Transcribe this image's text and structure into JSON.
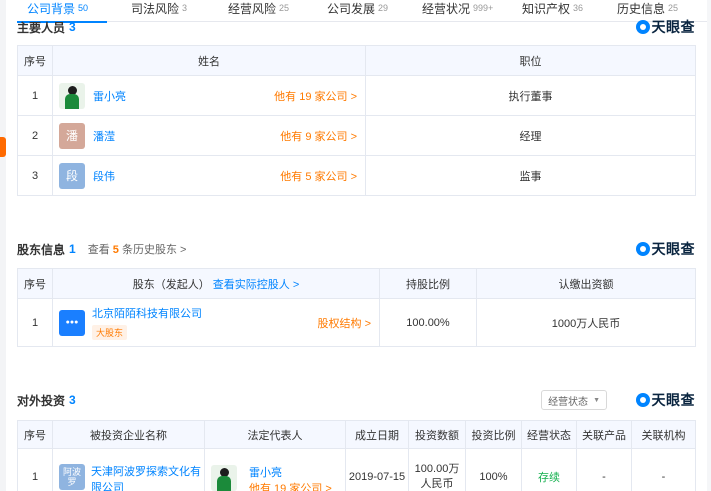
{
  "top_tabs": [
    {
      "label": "公司背景",
      "count": "50",
      "active": true
    },
    {
      "label": "司法风险",
      "count": "3"
    },
    {
      "label": "经营风险",
      "count": "25"
    },
    {
      "label": "公司发展",
      "count": "29"
    },
    {
      "label": "经营状况",
      "count": "999+"
    },
    {
      "label": "知识产权",
      "count": "36"
    },
    {
      "label": "历史信息",
      "count": "25"
    }
  ],
  "brand": {
    "logo_text": "天眼查"
  },
  "personnel": {
    "title": "主要人员",
    "count": "3",
    "headers": {
      "index": "序号",
      "name": "姓名",
      "position": "职位"
    },
    "rows": [
      {
        "index": "1",
        "name": "雷小亮",
        "more": "他有 19 家公司 >",
        "position": "执行董事"
      },
      {
        "index": "2",
        "avatar_char": "潘",
        "name": "潘滢",
        "more": "他有 9 家公司 >",
        "position": "经理"
      },
      {
        "index": "3",
        "avatar_char": "段",
        "name": "段伟",
        "more": "他有 5 家公司 >",
        "position": "监事"
      }
    ]
  },
  "shareholders": {
    "title": "股东信息",
    "count": "1",
    "history_prefix": "查看",
    "history_count": "5",
    "history_suffix": "条历史股东 >",
    "headers": {
      "index": "序号",
      "holder": "股东（发起人）",
      "holder_link": "查看实际控股人 >",
      "ratio": "持股比例",
      "capital": "认缴出资额"
    },
    "rows": [
      {
        "index": "1",
        "name": "北京陌陌科技有限公司",
        "tag": "大股东",
        "structure": "股权结构 >",
        "ratio": "100.00%",
        "capital": "1000万人民币"
      }
    ]
  },
  "investments": {
    "title": "对外投资",
    "count": "3",
    "filter_label": "经营状态",
    "headers": {
      "index": "序号",
      "company": "被投资企业名称",
      "legal_rep": "法定代表人",
      "date": "成立日期",
      "amount": "投资数额",
      "ratio": "投资比例",
      "status": "经营状态",
      "product": "关联产品",
      "org": "关联机构"
    },
    "rows": [
      {
        "index": "1",
        "logo_text": "阿波罗",
        "company": "天津阿波罗探索文化有限公司",
        "rep": "雷小亮",
        "rep_more": "他有 19 家公司 >",
        "date": "2019-07-15",
        "amount": "100.00万人民币",
        "ratio": "100%",
        "status": "存续",
        "product": "-",
        "org": "-"
      }
    ]
  },
  "colors": {
    "accent": "#0084ff",
    "orange": "#ff7a00",
    "green": "#14b04e"
  }
}
